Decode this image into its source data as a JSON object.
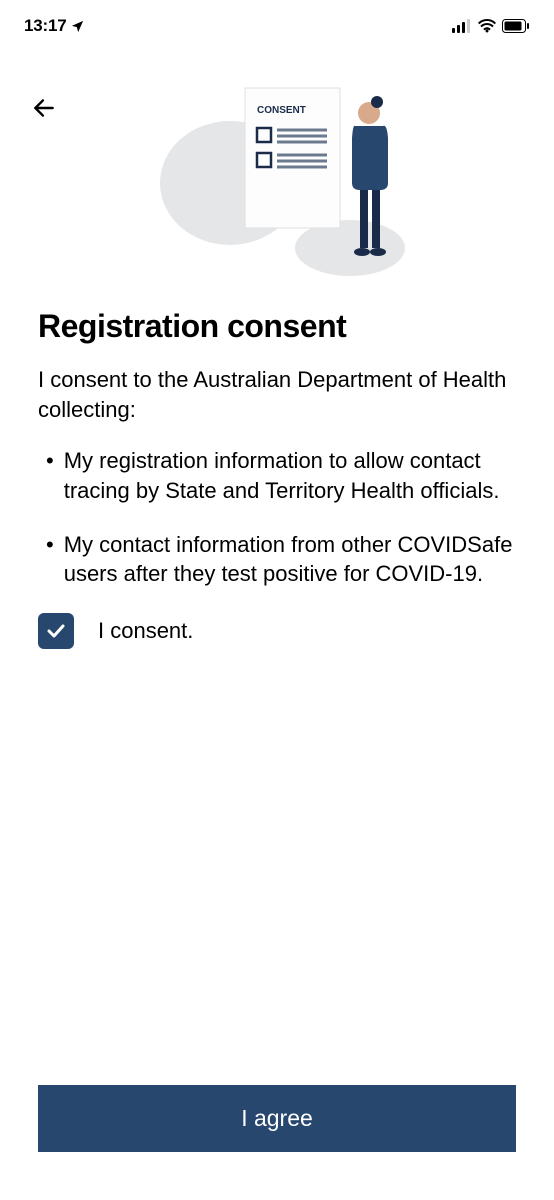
{
  "status": {
    "time": "13:17",
    "location_icon": "location-arrow",
    "signal": "signal",
    "wifi": "wifi",
    "battery": "battery"
  },
  "illustration": {
    "doc_label": "CONSENT"
  },
  "page": {
    "title": "Registration consent",
    "intro": "I consent to the Australian Department of Health collecting:",
    "bullets": [
      "My registration information to allow contact tracing by State and Territory Health officials.",
      "My contact information from other COVIDSafe users after they test positive for COVID-19."
    ],
    "consent_label": "I consent.",
    "agree_label": "I agree"
  },
  "colors": {
    "primary": "#28476e"
  }
}
